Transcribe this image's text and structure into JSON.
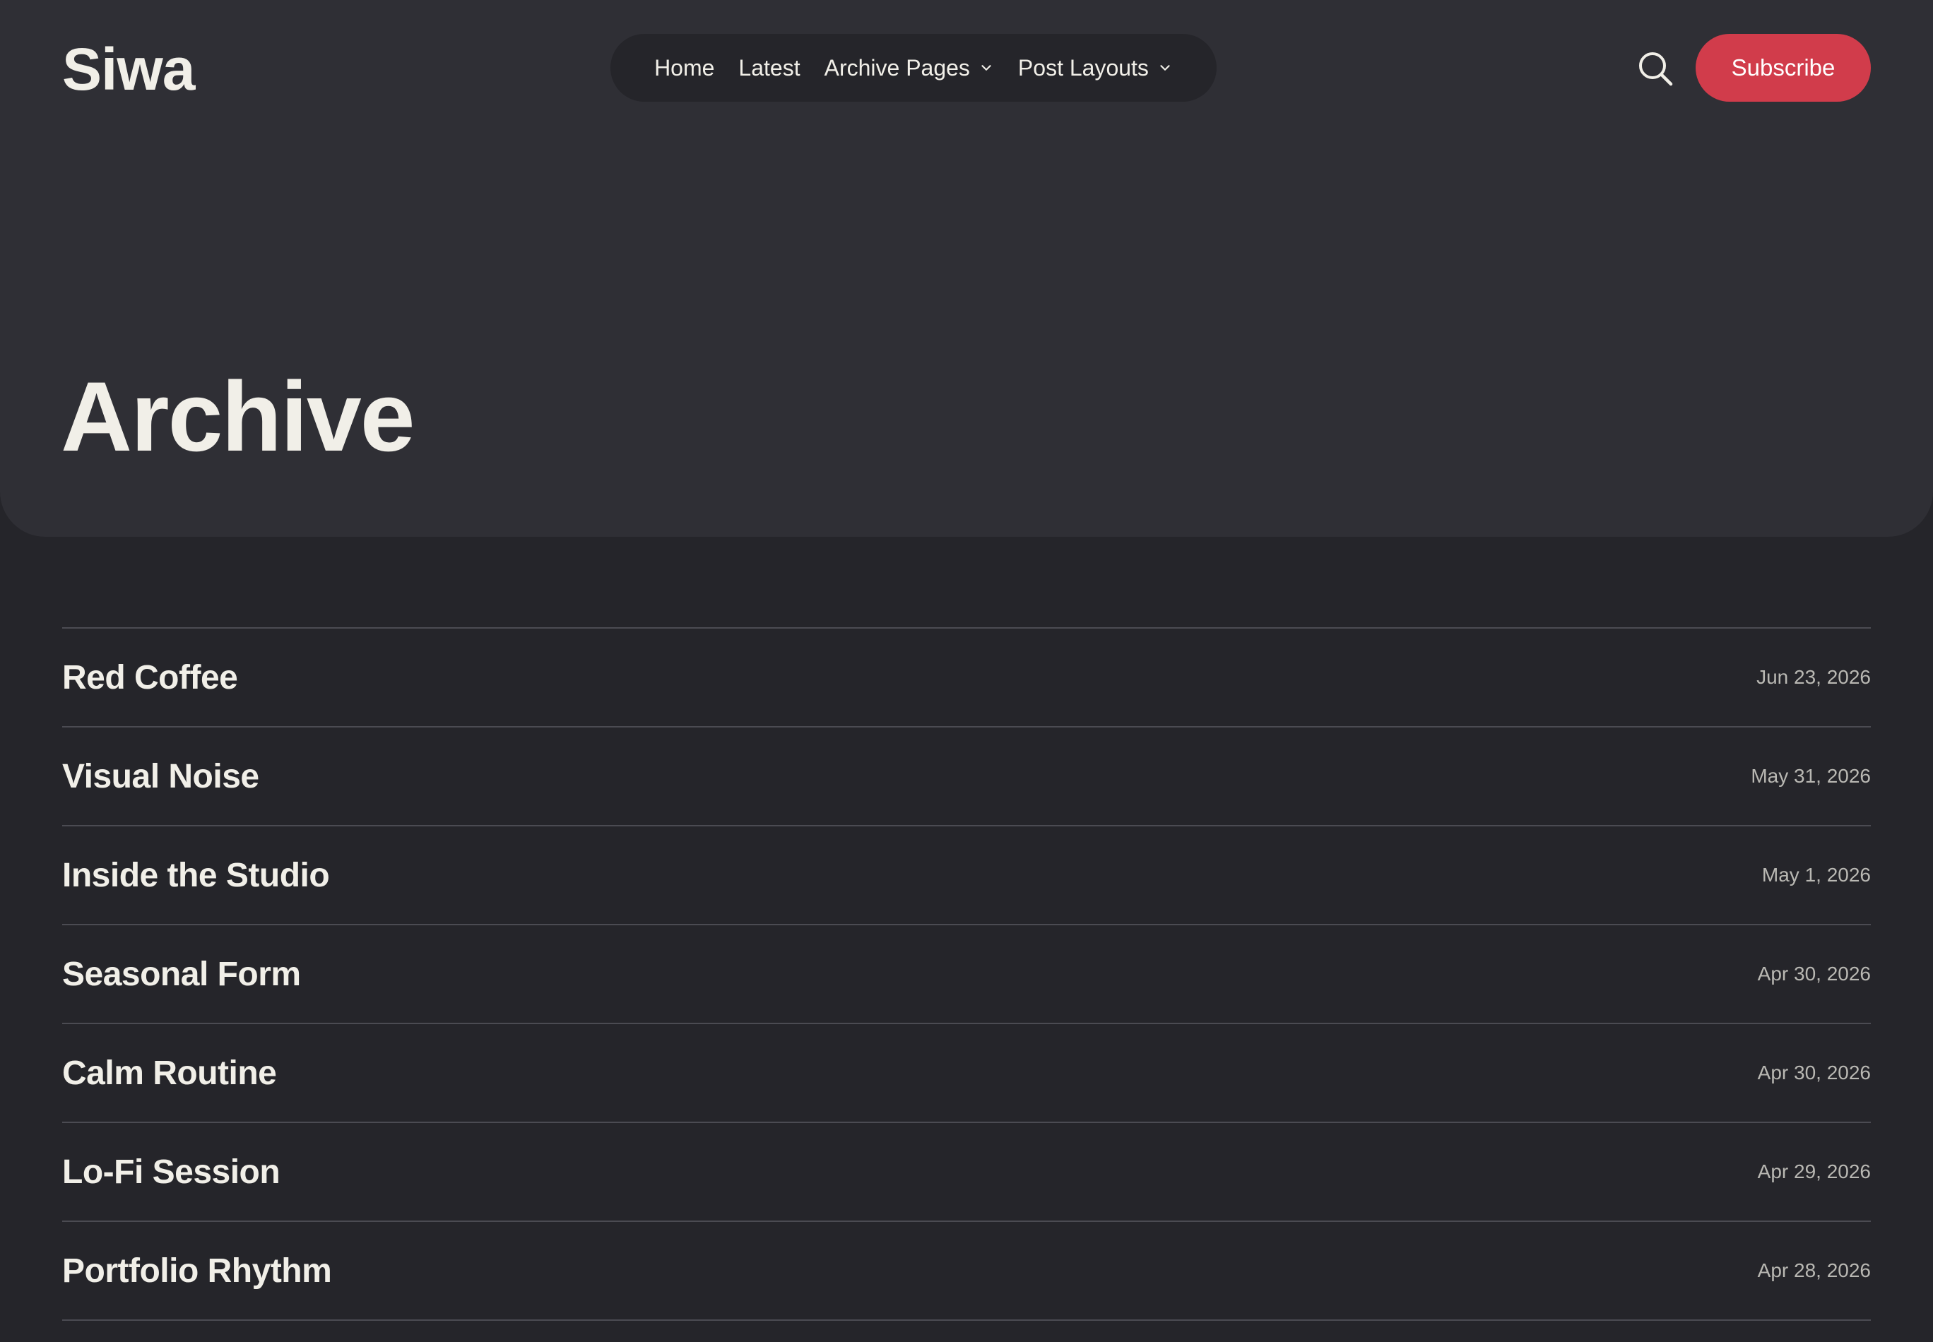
{
  "site": {
    "logo": "Siwa"
  },
  "nav": {
    "items": [
      {
        "label": "Home",
        "has_dropdown": false
      },
      {
        "label": "Latest",
        "has_dropdown": false
      },
      {
        "label": "Archive Pages",
        "has_dropdown": true
      },
      {
        "label": "Post Layouts",
        "has_dropdown": true
      }
    ]
  },
  "header": {
    "search_icon": "search-icon",
    "subscribe_label": "Subscribe"
  },
  "page": {
    "title": "Archive"
  },
  "posts": [
    {
      "title": "Red Coffee",
      "date": "Jun 23, 2026"
    },
    {
      "title": "Visual Noise",
      "date": "May 31, 2026"
    },
    {
      "title": "Inside the Studio",
      "date": "May 1, 2026"
    },
    {
      "title": "Seasonal Form",
      "date": "Apr 30, 2026"
    },
    {
      "title": "Calm Routine",
      "date": "Apr 30, 2026"
    },
    {
      "title": "Lo-Fi Session",
      "date": "Apr 29, 2026"
    },
    {
      "title": "Portfolio Rhythm",
      "date": "Apr 28, 2026"
    }
  ],
  "colors": {
    "background": "#25252a",
    "hero_background": "#2f2f35",
    "accent": "#d13c4b",
    "text": "#f1efe8",
    "muted_text": "#b9b8b3",
    "divider": "#4b4b52"
  }
}
